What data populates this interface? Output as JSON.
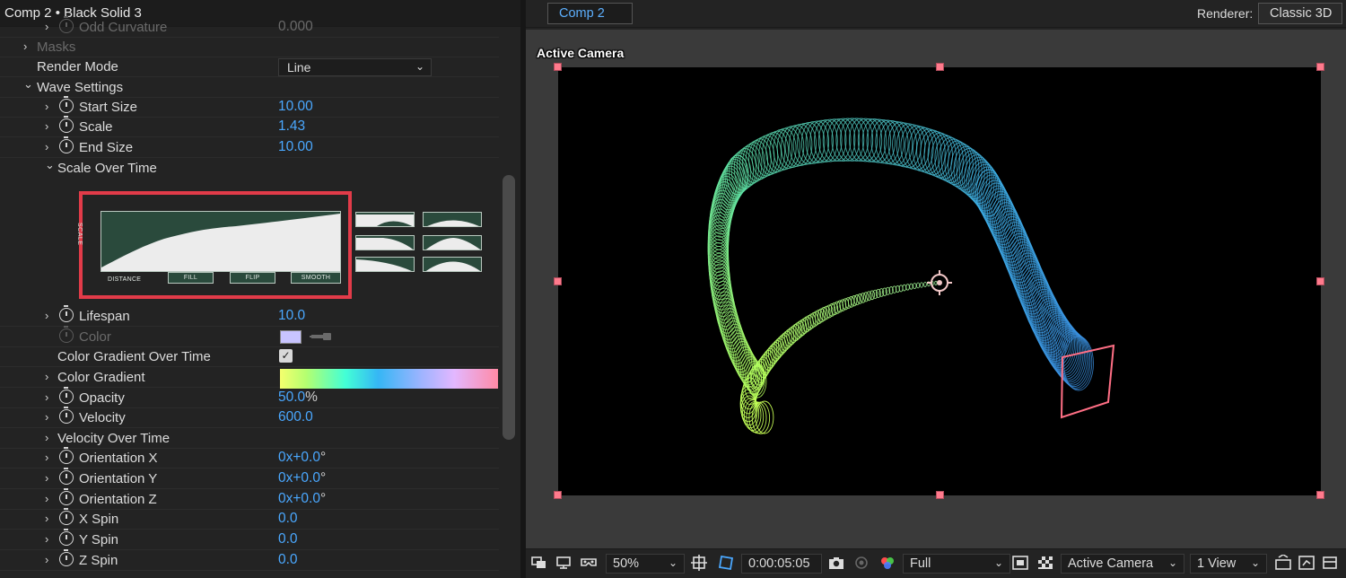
{
  "left_panel": {
    "title": "Comp 2 • Black Solid 3",
    "rows": {
      "odd_curvature": {
        "label": "Odd Curvature",
        "value": "0.000"
      },
      "masks": {
        "label": "Masks"
      },
      "render_mode": {
        "label": "Render Mode",
        "value": "Line"
      },
      "wave_settings": {
        "label": "Wave Settings"
      },
      "start_size": {
        "label": "Start Size",
        "value": "10.00"
      },
      "scale": {
        "label": "Scale",
        "value": "1.43"
      },
      "end_size": {
        "label": "End Size",
        "value": "10.00"
      },
      "scale_over_time": {
        "label": "Scale Over Time"
      },
      "lifespan": {
        "label": "Lifespan",
        "value": "10.0"
      },
      "color": {
        "label": "Color",
        "swatch_color": "#c8c4ff"
      },
      "color_gradient_over_time": {
        "label": "Color Gradient Over Time",
        "checked": true,
        "check_glyph": "✓"
      },
      "color_gradient": {
        "label": "Color Gradient"
      },
      "opacity": {
        "label": "Opacity",
        "value": "50.0",
        "unit": "%"
      },
      "velocity": {
        "label": "Velocity",
        "value": "600.0"
      },
      "velocity_over_time": {
        "label": "Velocity Over Time"
      },
      "orientation_x": {
        "label": "Orientation X",
        "value": "0x+0.0",
        "unit": "°"
      },
      "orientation_y": {
        "label": "Orientation Y",
        "value": "0x+0.0",
        "unit": "°"
      },
      "orientation_z": {
        "label": "Orientation Z",
        "value": "0x+0.0",
        "unit": "°"
      },
      "x_spin": {
        "label": "X Spin",
        "value": "0.0"
      },
      "y_spin": {
        "label": "Y Spin",
        "value": "0.0"
      },
      "z_spin": {
        "label": "Z Spin",
        "value": "0.0"
      }
    },
    "graph": {
      "y_label": "SCALE",
      "x_label": "DISTANCE",
      "buttons": [
        "FILL",
        "FLIP",
        "SMOOTH"
      ]
    },
    "icons": {
      "chevron_right": "›",
      "chevron_down": "⌄",
      "dropdown": "⌄"
    }
  },
  "right_panel": {
    "tab_label": "Comp 2",
    "renderer_label": "Renderer:",
    "renderer_value": "Classic 3D",
    "camera_label": "Active Camera",
    "toolbar": {
      "zoom": "50%",
      "timecode": "0:00:05:05",
      "resolution": "Full",
      "camera": "Active Camera",
      "views": "1 View"
    }
  },
  "colors": {
    "accent_blue": "#4aa8ff",
    "highlight_red": "#e23b49",
    "handle_pink": "#ff7a8c"
  }
}
